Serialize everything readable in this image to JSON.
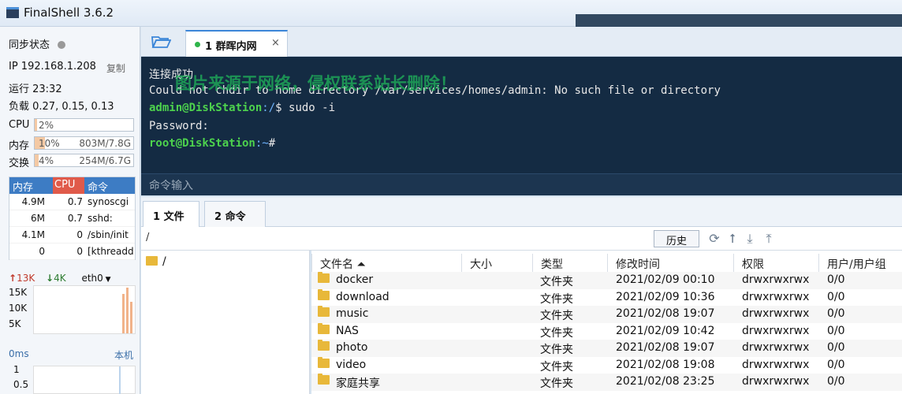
{
  "window": {
    "title": "FinalShell 3.6.2"
  },
  "status": {
    "sync_label": "同步状态",
    "ip": "IP 192.168.1.208",
    "copy_label": "复制",
    "uptime": "运行 23:32",
    "load": "负载 0.27, 0.15, 0.13",
    "cpu": {
      "label": "CPU",
      "pct_text": "2%",
      "fraction": 0.02
    },
    "mem": {
      "label": "内存",
      "pct_text": "10%",
      "size": "803M/7.8G",
      "fraction": 0.1
    },
    "swap": {
      "label": "交换",
      "pct_text": "4%",
      "size": "254M/6.7G",
      "fraction": 0.04
    }
  },
  "processes": {
    "headers": [
      "内存",
      "CPU",
      "命令"
    ],
    "rows": [
      {
        "mem": "4.9M",
        "cpu": "0.7",
        "cmd": "synoscgi"
      },
      {
        "mem": "6M",
        "cpu": "0.7",
        "cmd": "sshd:"
      },
      {
        "mem": "4.1M",
        "cpu": "0",
        "cmd": "/sbin/init"
      },
      {
        "mem": "0",
        "cpu": "0",
        "cmd": "[kthreadd"
      }
    ]
  },
  "network": {
    "up": "13K",
    "down": "4K",
    "iface": "eth0",
    "ticks": [
      "15K",
      "10K",
      "5K"
    ],
    "latency": "0ms",
    "host": "本机",
    "lat_ticks": [
      "1",
      "0.5"
    ]
  },
  "tabs": [
    {
      "label": "1 群晖内网",
      "close": "×"
    }
  ],
  "terminal": {
    "lines": [
      "连接成功",
      "Could not chdir to home directory /var/services/homes/admin: No such file or directory"
    ],
    "prompt1_user": "admin@DiskStation",
    "prompt1_path": ":/",
    "prompt1_cmd": "$ sudo -i",
    "password_line": "Password:",
    "prompt2_user": "root@DiskStation",
    "prompt2_path": ":~",
    "prompt2_cmd": "#",
    "watermark": "图片来源于网络，侵权联系站长删除！",
    "input_placeholder": "命令输入"
  },
  "bottom_tabs": [
    "1 文件",
    "2 命令"
  ],
  "path": "/",
  "history_label": "历史",
  "tree_root": "/",
  "files": {
    "headers": [
      "文件名 ⏶",
      "大小",
      "类型",
      "修改时间",
      "权限",
      "用户/用户组"
    ],
    "rows": [
      {
        "name": "docker",
        "type": "文件夹",
        "mtime": "2021/02/09 00:10",
        "perm": "drwxrwxrwx",
        "owner": "0/0"
      },
      {
        "name": "download",
        "type": "文件夹",
        "mtime": "2021/02/09 10:36",
        "perm": "drwxrwxrwx",
        "owner": "0/0"
      },
      {
        "name": "music",
        "type": "文件夹",
        "mtime": "2021/02/08 19:07",
        "perm": "drwxrwxrwx",
        "owner": "0/0"
      },
      {
        "name": "NAS",
        "type": "文件夹",
        "mtime": "2021/02/09 10:42",
        "perm": "drwxrwxrwx",
        "owner": "0/0"
      },
      {
        "name": "photo",
        "type": "文件夹",
        "mtime": "2021/02/08 19:07",
        "perm": "drwxrwxrwx",
        "owner": "0/0"
      },
      {
        "name": "video",
        "type": "文件夹",
        "mtime": "2021/02/08 19:08",
        "perm": "drwxrwxrwx",
        "owner": "0/0"
      },
      {
        "name": "家庭共享",
        "type": "文件夹",
        "mtime": "2021/02/08 23:25",
        "perm": "drwxrwxrwx",
        "owner": "0/0"
      }
    ]
  }
}
